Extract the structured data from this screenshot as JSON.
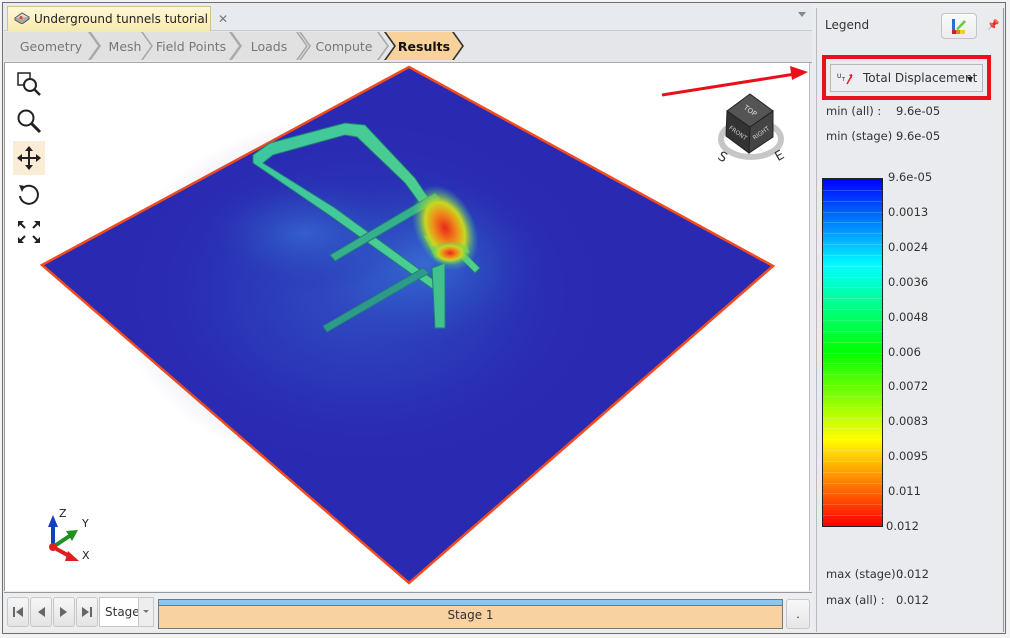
{
  "document_tab": {
    "title": "Underground tunnels tutorial",
    "close_icon": "close-icon",
    "icon": "model-icon"
  },
  "workflow": {
    "steps": [
      {
        "label": "Geometry",
        "active": false
      },
      {
        "label": "Mesh",
        "active": false
      },
      {
        "label": "Field Points",
        "active": false
      },
      {
        "label": "Loads",
        "active": false
      },
      {
        "label": "Compute",
        "active": false
      },
      {
        "label": "Results",
        "active": true
      }
    ]
  },
  "viewport_tools": [
    {
      "name": "zoom-window-icon",
      "active": false
    },
    {
      "name": "zoom-icon",
      "active": false
    },
    {
      "name": "pan-icon",
      "active": true
    },
    {
      "name": "rotate-icon",
      "active": false
    },
    {
      "name": "zoom-extents-icon",
      "active": false
    }
  ],
  "view_cube": {
    "faces": [
      "TOP",
      "FRONT",
      "RIGHT"
    ],
    "compass": [
      "S",
      "E"
    ]
  },
  "axis_triad": {
    "labels": [
      "Z",
      "Y",
      "X"
    ]
  },
  "stage_bar": {
    "buttons": [
      "first-stage",
      "previous-stage",
      "next-stage",
      "last-stage"
    ],
    "mode_select": "Stage",
    "current_stage": "Stage 1",
    "progress_fraction": 1.0,
    "more_button": "."
  },
  "legend": {
    "title": "Legend",
    "result_type": "Total Displacement",
    "result_icon": "total-displacement-icon",
    "min_all_label": "min (all) :",
    "min_all_value": "9.6e-05",
    "min_stage_label": "min (stage) :",
    "min_stage_value": "9.6e-05",
    "max_stage_label": "max (stage) :",
    "max_stage_value": "0.012",
    "max_all_label": "max (all) :",
    "max_all_value": "0.012",
    "scale_ticks": [
      "9.6e-05",
      "0.0013",
      "0.0024",
      "0.0036",
      "0.0048",
      "0.006",
      "0.0072",
      "0.0083",
      "0.0095",
      "0.011",
      "0.012"
    ],
    "scale_colors": [
      "#0000ff",
      "#00ffff",
      "#00ff00",
      "#ffff00",
      "#ff0000"
    ]
  },
  "annotation": {
    "highlight_color": "#e8101a"
  }
}
